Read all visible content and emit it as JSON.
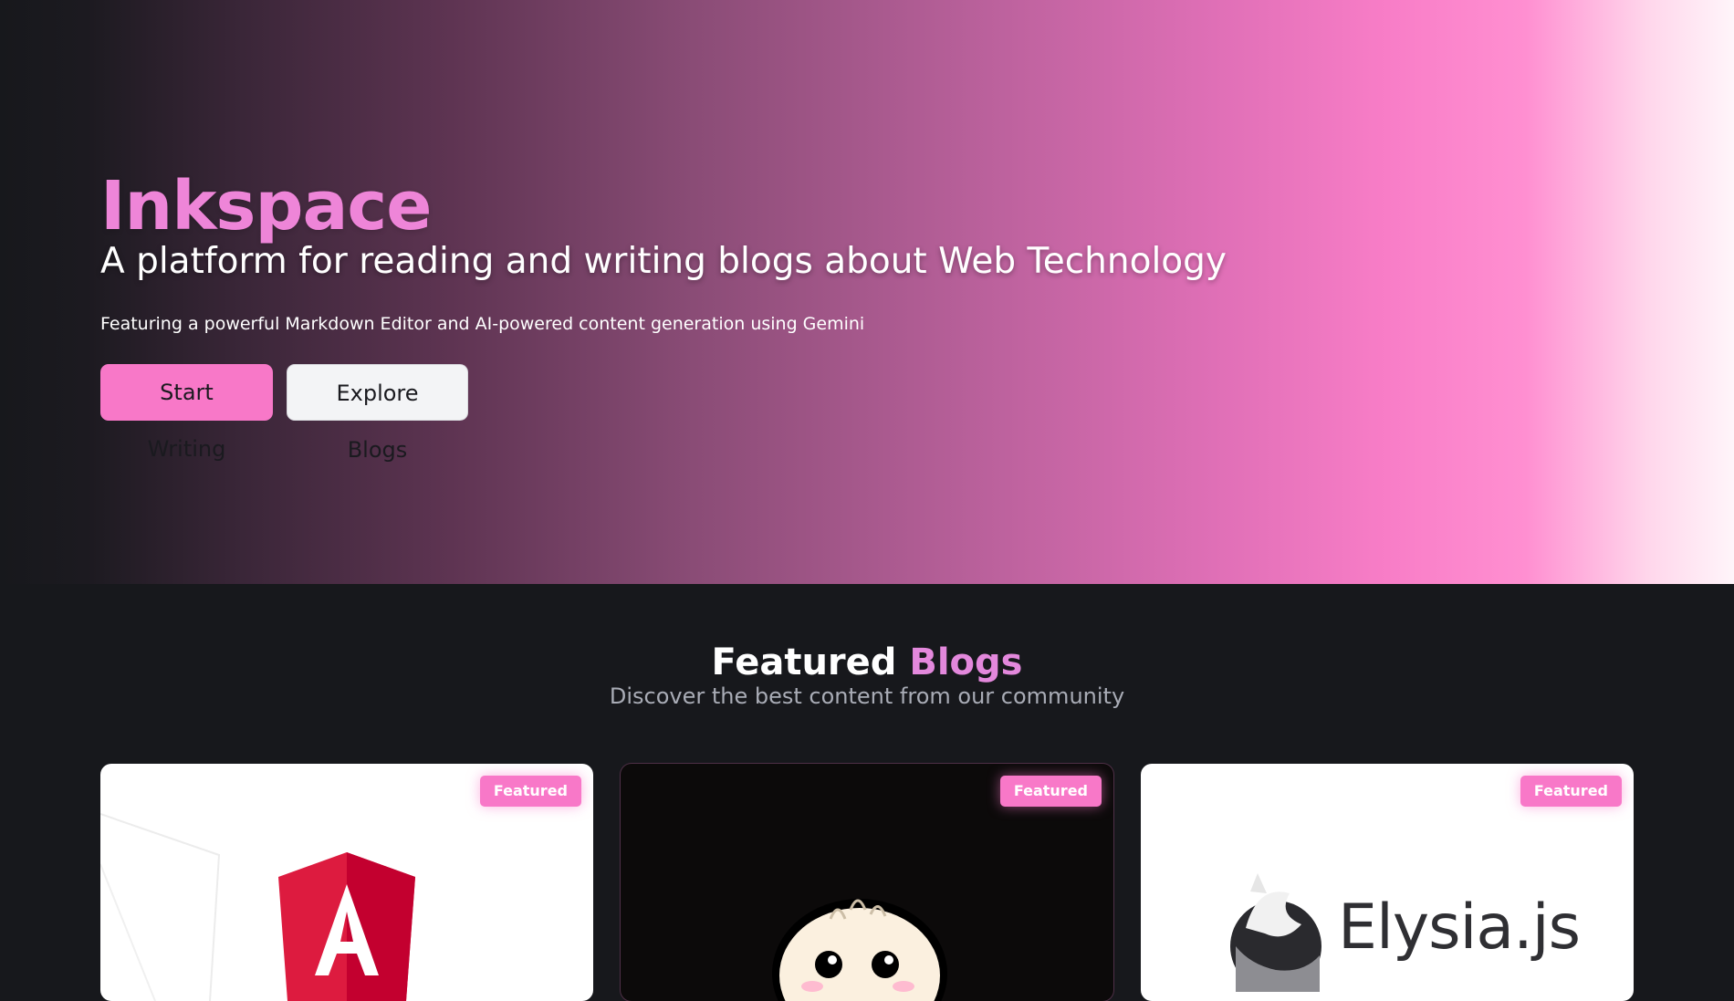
{
  "hero": {
    "title": "Inkspace",
    "tagline": "A platform for reading and writing blogs about Web Technology",
    "description": "Featuring a powerful Markdown Editor and AI-powered content generation using Gemini",
    "primary_button": "Start Writing",
    "secondary_button": "Explore Blogs"
  },
  "featured": {
    "heading_main": "Featured",
    "heading_accent": "Blogs",
    "subtitle": "Discover the best content from our community",
    "cards": [
      {
        "badge": "Featured",
        "image_icon": "angular-logo-icon"
      },
      {
        "badge": "Featured",
        "image_icon": "bun-logo-icon"
      },
      {
        "badge": "Featured",
        "image_icon": "elysia-logo-icon",
        "image_text": "Elysia.js"
      }
    ]
  },
  "colors": {
    "brand_pink": "#f878c8",
    "accent_purple": "#e388dc",
    "background": "#17181c"
  }
}
